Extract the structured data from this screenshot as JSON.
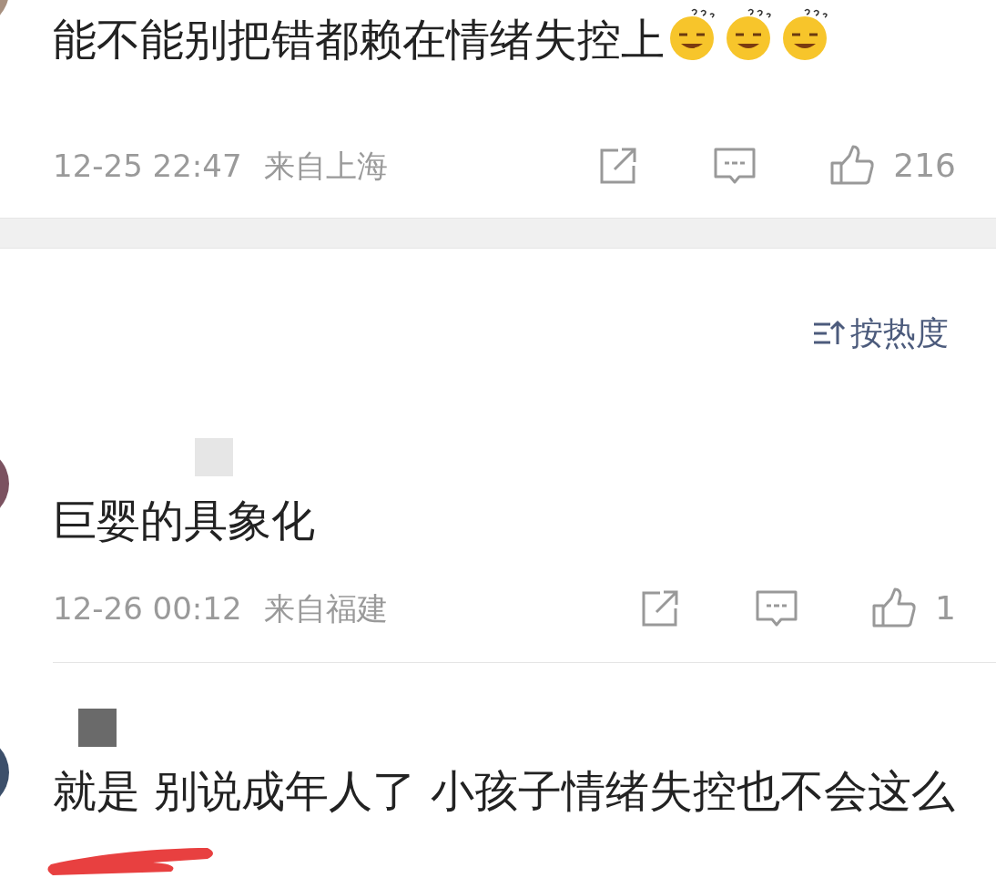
{
  "comments": [
    {
      "name_redacted": false,
      "text": "能不能别把错都赖在情绪失控上",
      "emojis": [
        {
          "kind": "puzzled-smile"
        },
        {
          "kind": "puzzled-smile"
        },
        {
          "kind": "puzzled-smile"
        }
      ],
      "time": "12-25 22:47",
      "location": "来自上海",
      "likes": "216",
      "redacted_tail": false
    },
    {
      "name_redacted": true,
      "text": "巨婴的具象化",
      "time": "12-26 00:12",
      "location": "来自福建",
      "likes": "1",
      "redacted_tail": false
    },
    {
      "name_redacted": true,
      "text": "就是 别说成年人了 小孩子情绪失控也不会这么",
      "redacted_tail": true
    }
  ],
  "sort": {
    "label": "按热度"
  }
}
